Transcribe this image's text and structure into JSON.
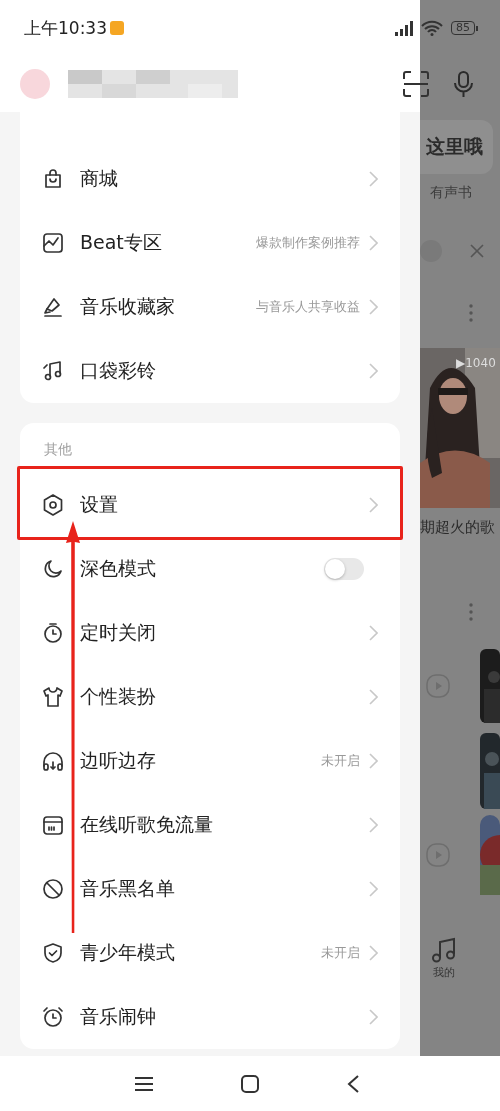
{
  "status_bar": {
    "time": "上午10:33",
    "battery": "85"
  },
  "drawer": {
    "groups": [
      {
        "items": [
          {
            "kind": "link",
            "label": "商城",
            "highlighted": false
          },
          {
            "kind": "link",
            "label": "Beat专区",
            "hint": "爆款制作案例推荐",
            "highlighted": false
          },
          {
            "kind": "link",
            "label": "音乐收藏家",
            "hint": "与音乐人共享收益",
            "highlighted": false
          },
          {
            "kind": "link",
            "label": "口袋彩铃",
            "highlighted": false
          }
        ]
      },
      {
        "title": "其他",
        "items": [
          {
            "kind": "link",
            "label": "设置",
            "highlighted": true
          },
          {
            "kind": "toggle",
            "label": "深色模式",
            "on": false,
            "highlighted": false
          },
          {
            "kind": "link",
            "label": "定时关闭",
            "highlighted": false
          },
          {
            "kind": "link",
            "label": "个性装扮",
            "highlighted": false
          },
          {
            "kind": "link",
            "label": "边听边存",
            "hint": "未开启",
            "highlighted": false
          },
          {
            "kind": "link",
            "label": "在线听歌免流量",
            "highlighted": false
          },
          {
            "kind": "link",
            "label": "音乐黑名单",
            "highlighted": false
          },
          {
            "kind": "link",
            "label": "青少年模式",
            "hint": "未开启",
            "highlighted": false
          },
          {
            "kind": "link",
            "label": "音乐闹钟",
            "highlighted": false
          }
        ]
      }
    ]
  },
  "background_page": {
    "tip": "这里哦",
    "tab_label": "有声书",
    "play_count": "▶1040",
    "caption": "期超火的歌",
    "nav_label": "我的"
  }
}
